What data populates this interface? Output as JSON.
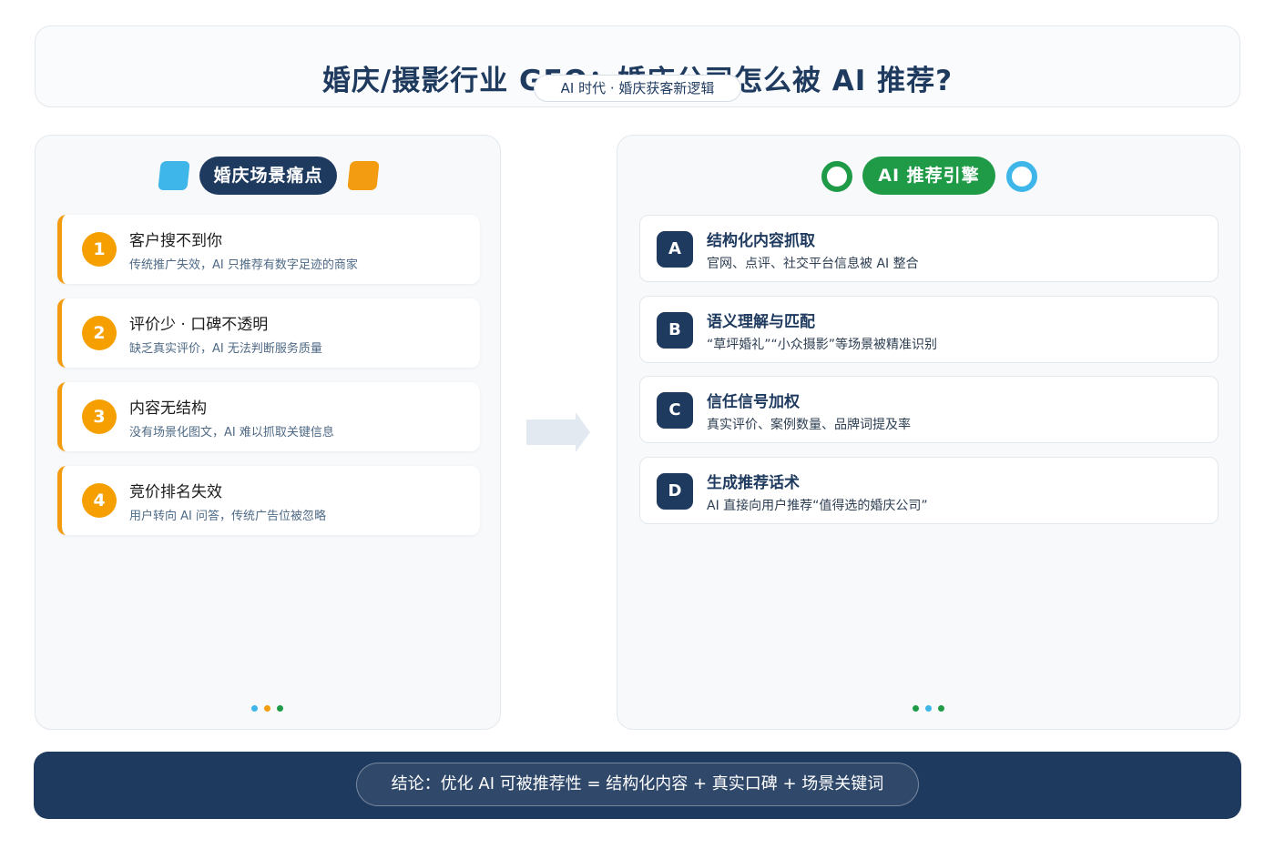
{
  "header": {
    "title": "婚庆/摄影行业 GEO：婚庆公司怎么被 AI 推荐?",
    "subtitle": "AI 时代 · 婚庆获客新逻辑"
  },
  "left_panel": {
    "title": "婚庆场景痛点",
    "items": [
      {
        "num": "1",
        "title": "客户搜不到你",
        "desc": "传统推广失效，AI 只推荐有数字足迹的商家"
      },
      {
        "num": "2",
        "title": "评价少 · 口碑不透明",
        "desc": "缺乏真实评价，AI 无法判断服务质量"
      },
      {
        "num": "3",
        "title": "内容无结构",
        "desc": "没有场景化图文，AI 难以抓取关键信息"
      },
      {
        "num": "4",
        "title": "竞价排名失效",
        "desc": "用户转向 AI 问答，传统广告位被忽略"
      }
    ]
  },
  "right_panel": {
    "title": "AI 推荐引擎",
    "items": [
      {
        "letter": "A",
        "title": "结构化内容抓取",
        "desc": "官网、点评、社交平台信息被 AI 整合"
      },
      {
        "letter": "B",
        "title": "语义理解与匹配",
        "desc": "“草坪婚礼”“小众摄影”等场景被精准识别"
      },
      {
        "letter": "C",
        "title": "信任信号加权",
        "desc": "真实评价、案例数量、品牌词提及率"
      },
      {
        "letter": "D",
        "title": "生成推荐话术",
        "desc": "AI 直接向用户推荐“值得选的婚庆公司”"
      }
    ]
  },
  "footer": {
    "conclusion": "结论：优化 AI 可被推荐性 = 结构化内容 + 真实口碑 + 场景关键词"
  },
  "colors": {
    "navy": "#1f3a5f",
    "orange": "#f5a000",
    "green": "#1f9a47",
    "sky": "#3fb6ea"
  }
}
